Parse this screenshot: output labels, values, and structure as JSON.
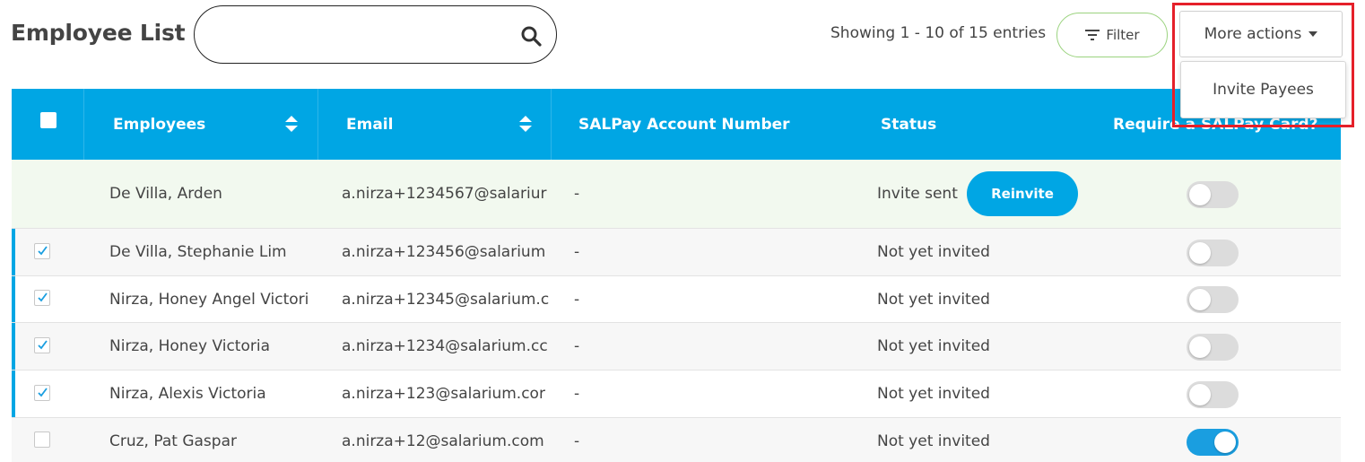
{
  "header": {
    "title": "Employee List",
    "search_placeholder": "",
    "entries_info": "Showing 1 - 10 of 15 entries",
    "filter_label": "Filter",
    "more_actions_label": "More actions"
  },
  "dropdown": {
    "items": [
      {
        "label": "Invite Payees"
      }
    ]
  },
  "table": {
    "columns": [
      "Employees",
      "Email",
      "SALPay Account Number",
      "Status",
      "Require a SALPay Card?"
    ],
    "rows": [
      {
        "name": "De Villa, Arden",
        "email": "a.nirza+1234567@salariur",
        "account": "-",
        "status": "Invite sent",
        "action": "Reinvite",
        "checked": false,
        "selected": false,
        "card": false
      },
      {
        "name": "De Villa, Stephanie Lim",
        "email": "a.nirza+123456@salarium",
        "account": "-",
        "status": "Not yet invited",
        "checked": true,
        "selected": true,
        "card": false
      },
      {
        "name": "Nirza, Honey Angel Victori",
        "email": "a.nirza+12345@salarium.c",
        "account": "-",
        "status": "Not yet invited",
        "checked": true,
        "selected": true,
        "card": false
      },
      {
        "name": "Nirza, Honey Victoria",
        "email": "a.nirza+1234@salarium.cc",
        "account": "-",
        "status": "Not yet invited",
        "checked": true,
        "selected": true,
        "card": false
      },
      {
        "name": "Nirza, Alexis Victoria",
        "email": "a.nirza+123@salarium.cor",
        "account": "-",
        "status": "Not yet invited",
        "checked": true,
        "selected": true,
        "card": false
      },
      {
        "name": "Cruz, Pat Gaspar",
        "email": "a.nirza+12@salarium.com",
        "account": "-",
        "status": "Not yet invited",
        "checked": false,
        "selected": false,
        "card": true
      }
    ]
  },
  "colors": {
    "header_blue": "#00a6e4",
    "annotation_red": "#e5202a",
    "filter_border": "#9bd37f",
    "highlight_row": "#f2f9ef"
  },
  "icons": {
    "search": "search-icon",
    "filter": "filter-icon",
    "caret": "caret-down-icon",
    "sort": "sort-icon",
    "check": "check-icon"
  }
}
